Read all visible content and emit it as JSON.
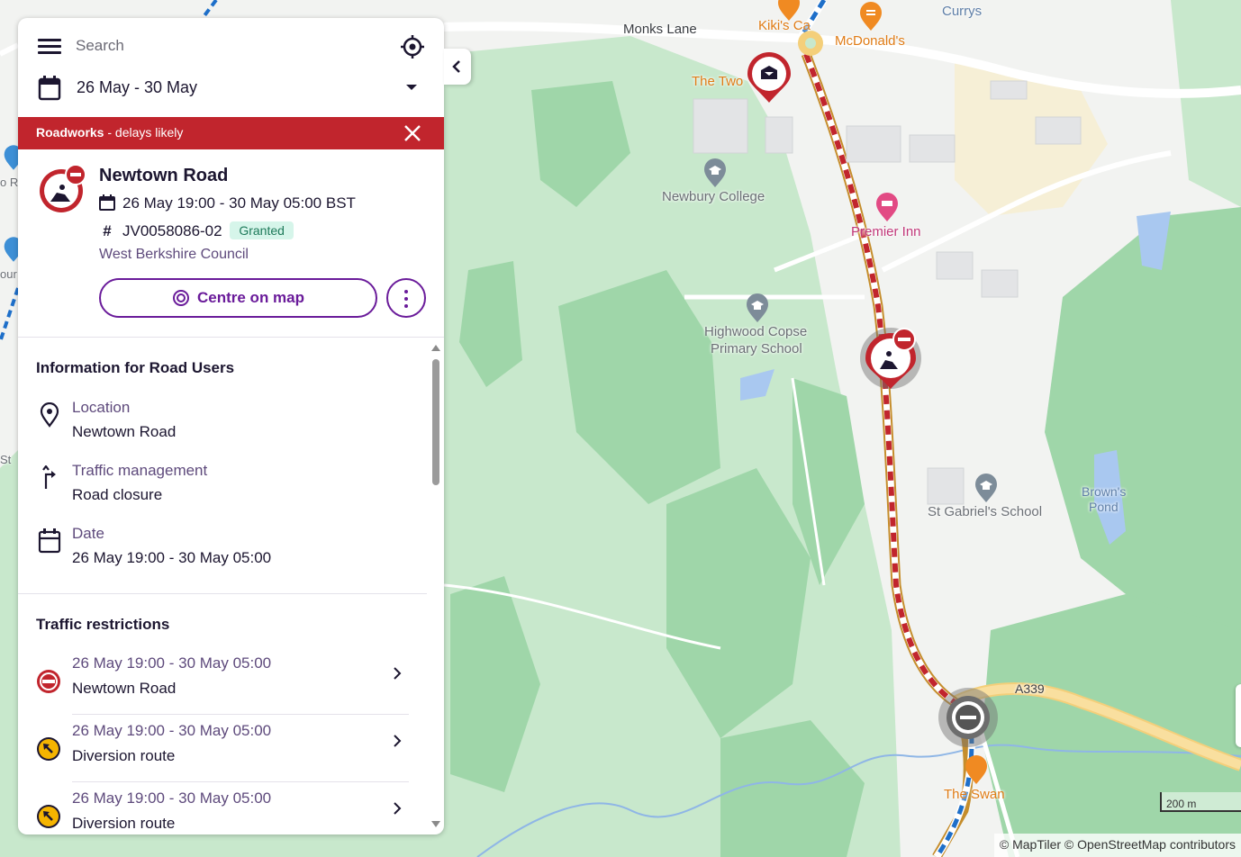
{
  "search": {
    "placeholder": "Search"
  },
  "date_filter": {
    "label": "26 May - 30 May"
  },
  "alert": {
    "title": "Roadworks",
    "subtitle": " - delays likely"
  },
  "work": {
    "road": "Newtown Road",
    "dates": "26 May 19:00 - 30 May 05:00 BST",
    "reference": "JV0058086-02",
    "status": "Granted",
    "council": "West Berkshire Council",
    "centre_button": "Centre on map"
  },
  "info": {
    "title": "Information for Road Users",
    "items": [
      {
        "icon": "location-pin-icon",
        "label": "Location",
        "value": "Newtown Road"
      },
      {
        "icon": "traffic-management-icon",
        "label": "Traffic management",
        "value": "Road closure"
      },
      {
        "icon": "calendar-icon",
        "label": "Date",
        "value": "26 May 19:00 - 30 May 05:00"
      }
    ]
  },
  "restrictions": {
    "title": "Traffic restrictions",
    "items": [
      {
        "icon": "no-entry-icon",
        "dates": "26 May 19:00 - 30 May 05:00",
        "name": "Newtown Road"
      },
      {
        "icon": "diversion-icon",
        "dates": "26 May 19:00 - 30 May 05:00",
        "name": "Diversion route"
      },
      {
        "icon": "diversion-icon",
        "dates": "26 May 19:00 - 30 May 05:00",
        "name": "Diversion route"
      }
    ]
  },
  "map": {
    "labels": {
      "monks_lane": "Monks Lane",
      "kikis": "Kiki's Ca",
      "mcdonalds": "McDonald's",
      "currys": "Currys",
      "the_two": "The Two",
      "newbury_college": "Newbury College",
      "premier_inn": "Premier Inn",
      "highwood_1": "Highwood Copse",
      "highwood_2": "Primary School",
      "st_gabriels": "St Gabriel's School",
      "browns_1": "Brown's",
      "browns_2": "Pond",
      "a339": "A339",
      "the_swan": "The Swan",
      "edge_o": "o R",
      "edge_our": "our",
      "edge_st": "St"
    },
    "scale": "200 m",
    "attribution": "© MapTiler © OpenStreetMap contributors"
  },
  "colors": {
    "accent": "#6a1b9a",
    "alert": "#c1252d",
    "granted_bg": "#d6f5ea",
    "park": "#9fd6a9",
    "water": "#a9c8f0"
  }
}
